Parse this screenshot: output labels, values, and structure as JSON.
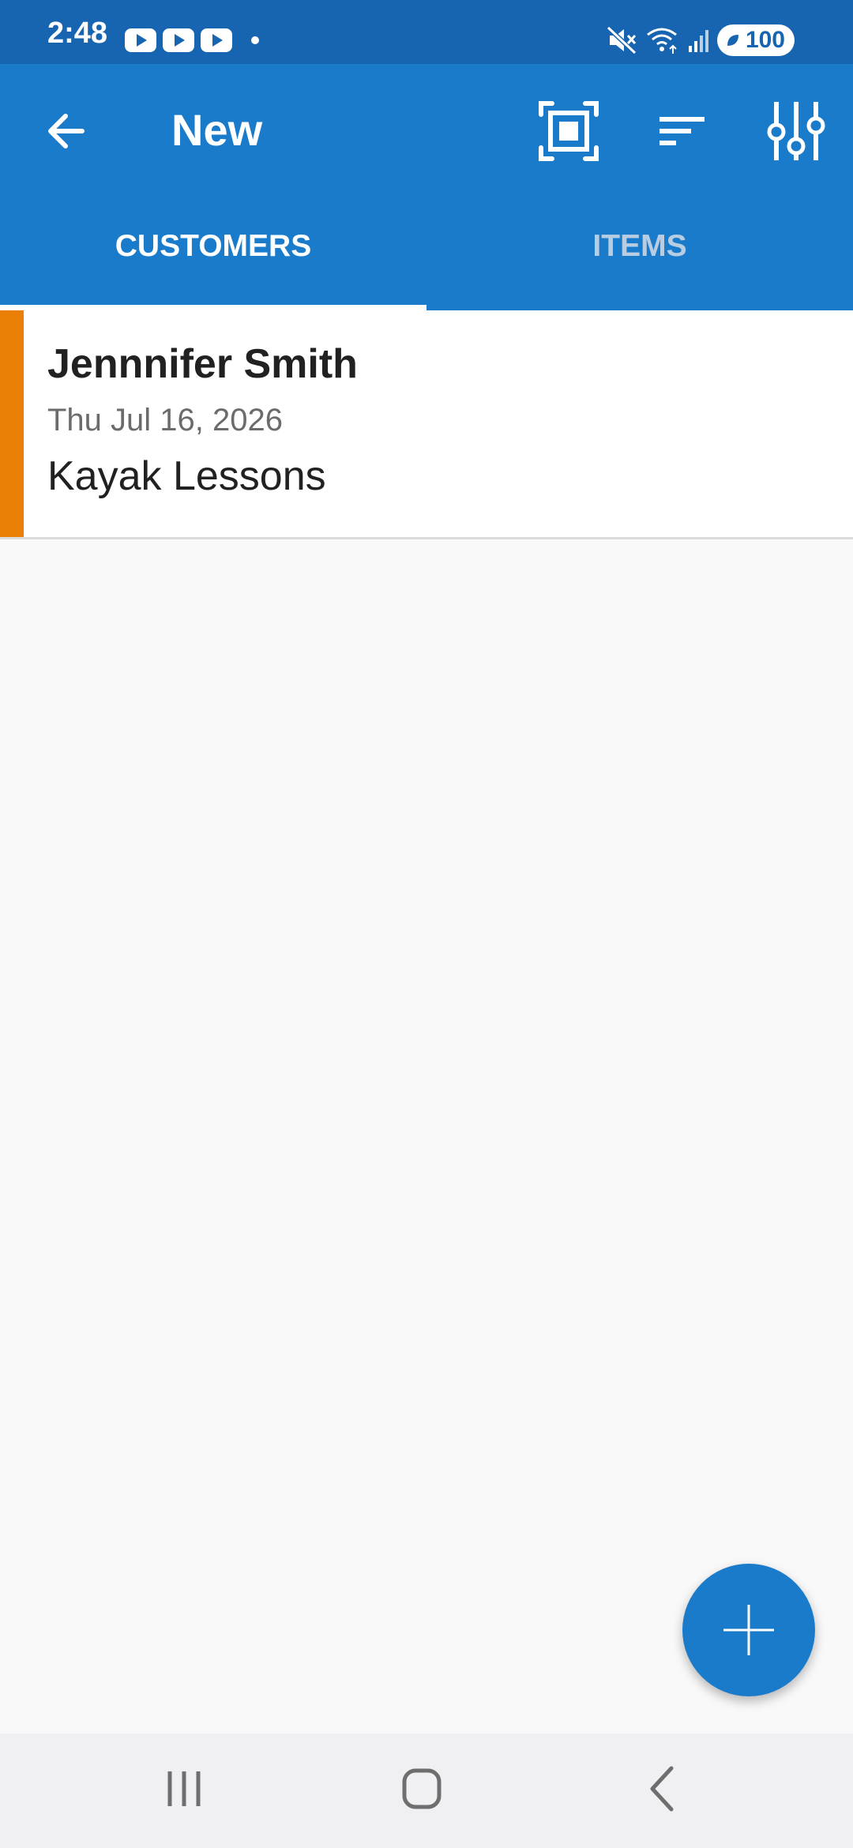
{
  "status_bar": {
    "time": "2:48",
    "notification_icons": [
      "youtube-icon",
      "youtube-icon",
      "youtube-icon",
      "more-notifications-dot-icon"
    ],
    "system_icons": [
      "mute-icon",
      "wifi-icon",
      "signal-icon"
    ],
    "battery": "100",
    "color": "#1765b0"
  },
  "app_bar": {
    "title": "New",
    "back_icon": "arrow-left-icon",
    "actions": [
      "scan-icon",
      "sort-icon",
      "filter-sliders-icon"
    ],
    "color": "#1a7bcb"
  },
  "tabs": [
    {
      "label": "CUSTOMERS",
      "selected": true
    },
    {
      "label": "ITEMS",
      "selected": false
    }
  ],
  "list": [
    {
      "name": "Jennnifer Smith",
      "date": "Thu Jul 16, 2026",
      "item": "Kayak Lessons",
      "stripe_color": "#ea8106"
    }
  ],
  "fab": {
    "icon": "plus-icon",
    "color": "#1a7bcb"
  },
  "nav_bar": {
    "buttons": [
      "recents-icon",
      "home-icon",
      "back-icon"
    ]
  }
}
